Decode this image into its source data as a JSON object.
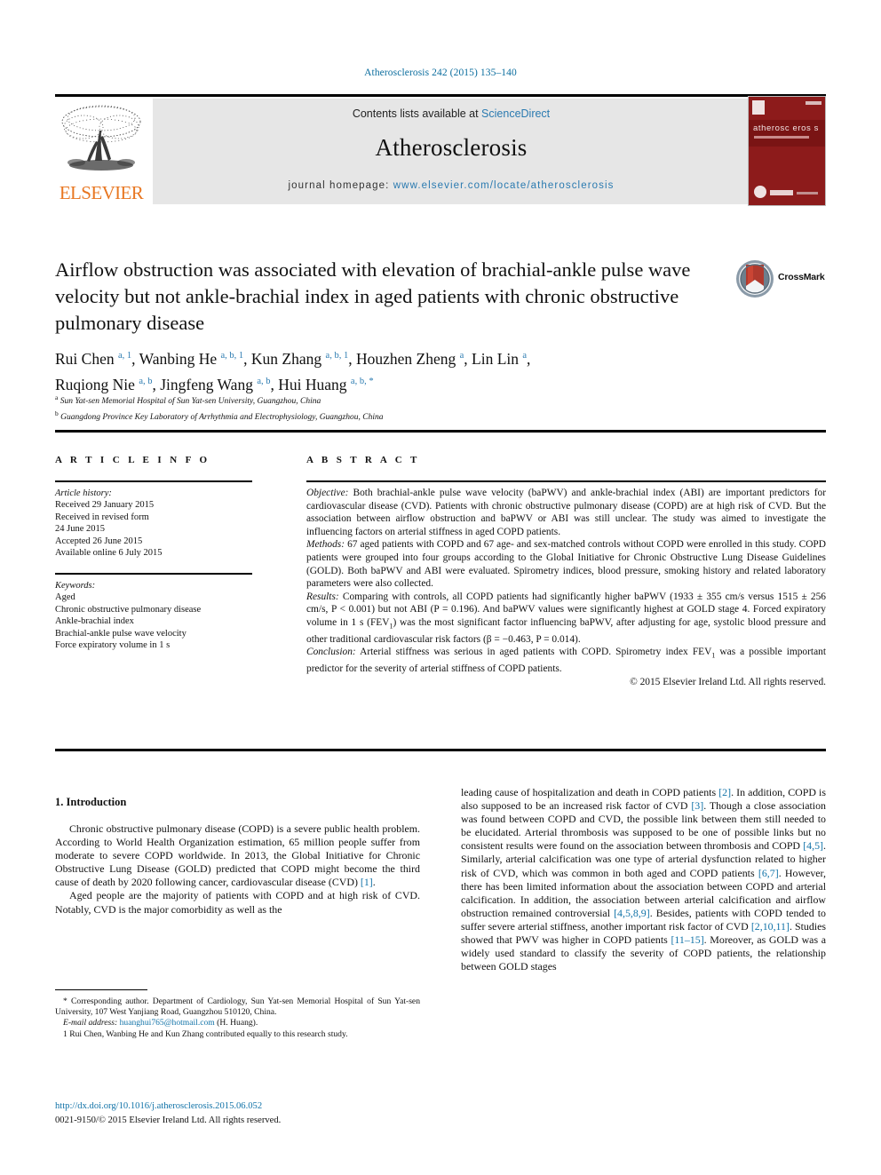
{
  "running_head": "Atherosclerosis 242 (2015) 135–140",
  "masthead": {
    "contents_prefix": "Contents lists available at ",
    "contents_link": "ScienceDirect",
    "journal_name": "Atherosclerosis",
    "homepage_prefix": "journal homepage: ",
    "homepage_url": "www.elsevier.com/locate/atherosclerosis",
    "publisher": "ELSEVIER",
    "cover_title": "atherosc eros s"
  },
  "article": {
    "title": "Airflow obstruction was associated with elevation of brachial-ankle pulse wave velocity but not ankle-brachial index in aged patients with chronic obstructive pulmonary disease",
    "crossmark_label": "CrossMark",
    "authors_line1": "Rui Chen, Wanbing He, Kun Zhang, Houzhen Zheng, Lin Lin,",
    "authors_line2": "Ruqiong Nie, Jingfeng Wang, Hui Huang",
    "affiliation_a": "Sun Yat-sen Memorial Hospital of Sun Yat-sen University, Guangzhou, China",
    "affiliation_b": "Guangdong Province Key Laboratory of Arrhythmia and Electrophysiology, Guangzhou, China"
  },
  "headings": {
    "article_info": "A R T I C L E   I N F O",
    "abstract": "A B S T R A C T",
    "introduction": "1.  Introduction"
  },
  "article_history": {
    "label": "Article history:",
    "lines": [
      "Received 29 January 2015",
      "Received in revised form",
      "24 June 2015",
      "Accepted 26 June 2015",
      "Available online 6 July 2015"
    ]
  },
  "keywords": {
    "label": "Keywords:",
    "items": [
      "Aged",
      "Chronic obstructive pulmonary disease",
      "Ankle-brachial index",
      "Brachial-ankle pulse wave velocity",
      "Force expiratory volume in 1 s"
    ]
  },
  "abstract": {
    "objective_label": "Objective:",
    "objective_text": " Both brachial-ankle pulse wave velocity (baPWV) and ankle-brachial index (ABI) are important predictors for cardiovascular disease (CVD). Patients with chronic obstructive pulmonary disease (COPD) are at high risk of CVD. But the association between airflow obstruction and baPWV or ABI was still unclear. The study was aimed to investigate the influencing factors on arterial stiffness in aged COPD patients.",
    "methods_label": "Methods:",
    "methods_text": " 67 aged patients with COPD and 67 age- and sex-matched controls without COPD were enrolled in this study. COPD patients were grouped into four groups according to the Global Initiative for Chronic Obstructive Lung Disease Guidelines (GOLD). Both baPWV and ABI were evaluated. Spirometry indices, blood pressure, smoking history and related laboratory parameters were also collected.",
    "results_label": "Results:",
    "results_text_a": " Comparing with controls, all COPD patients had significantly higher baPWV (1933 ± 355 cm/s versus 1515 ± 256 cm/s, P < 0.001) but not ABI (P = 0.196). And baPWV values were significantly highest at GOLD stage 4. Forced expiratory volume in 1 s (FEV",
    "results_sub": "1",
    "results_text_b": ") was the most significant factor influencing baPWV, after adjusting for age, systolic blood pressure and other traditional cardiovascular risk factors (β = −0.463, P = 0.014).",
    "conclusion_label": "Conclusion:",
    "conclusion_text_a": " Arterial stiffness was serious in aged patients with COPD. Spirometry index FEV",
    "conclusion_sub": "1",
    "conclusion_text_b": " was a possible important predictor for the severity of arterial stiffness of COPD patients.",
    "copyright": "© 2015 Elsevier Ireland Ltd. All rights reserved."
  },
  "body": {
    "left_p1_a": "Chronic obstructive pulmonary disease (COPD) is a severe public health problem. According to World Health Organization estimation, 65 million people suffer from moderate to severe COPD worldwide. In 2013, the Global Initiative for Chronic Obstructive Lung Disease (GOLD) predicted that COPD might become the third cause of death by 2020 following cancer, cardiovascular disease (CVD) ",
    "left_p1_ref": "[1]",
    "left_p1_b": ".",
    "left_p2": "Aged people are the majority of patients with COPD and at high risk of CVD. Notably, CVD is the major comorbidity as well as the",
    "right_seg": [
      {
        "t": "leading cause of hospitalization and death in COPD patients "
      },
      {
        "r": "[2]"
      },
      {
        "t": ". In addition, COPD is also supposed to be an increased risk factor of CVD "
      },
      {
        "r": "[3]"
      },
      {
        "t": ". Though a close association was found between COPD and CVD, the possible link between them still needed to be elucidated. Arterial thrombosis was supposed to be one of possible links but no consistent results were found on the association between thrombosis and COPD "
      },
      {
        "r": "[4,5]"
      },
      {
        "t": ". Similarly, arterial calcification was one type of arterial dysfunction related to higher risk of CVD, which was common in both aged and COPD patients "
      },
      {
        "r": "[6,7]"
      },
      {
        "t": ". However, there has been limited information about the association between COPD and arterial calcification. In addition, the association between arterial calcification and airflow obstruction remained controversial "
      },
      {
        "r": "[4,5,8,9]"
      },
      {
        "t": ". Besides, patients with COPD tended to suffer severe arterial stiffness, another important risk factor of CVD "
      },
      {
        "r": "[2,10,11]"
      },
      {
        "t": ". Studies showed that PWV was higher in COPD patients "
      },
      {
        "r": "[11–15]"
      },
      {
        "t": ". Moreover, as GOLD was a widely used standard to classify the severity of COPD patients, the relationship between GOLD stages"
      }
    ]
  },
  "footnotes": {
    "corresponding": "* Corresponding author. Department of Cardiology, Sun Yat-sen Memorial Hospital of Sun Yat-sen University, 107 West Yanjiang Road, Guangzhou 510120, China.",
    "email_label": "E-mail address:",
    "email_link": "huanghui765@hotmail.com",
    "email_suffix": " (H. Huang).",
    "equal_contrib": "1 Rui Chen, Wanbing He and Kun Zhang contributed equally to this research study.",
    "doi": "http://dx.doi.org/10.1016/j.atherosclerosis.2015.06.052",
    "issn": "0021-9150/© 2015 Elsevier Ireland Ltd. All rights reserved."
  },
  "colors": {
    "link": "#1273a8",
    "elsevier_orange": "#E87722",
    "cover_red": "#8d1b1b",
    "band_gray": "#e6e6e6"
  }
}
